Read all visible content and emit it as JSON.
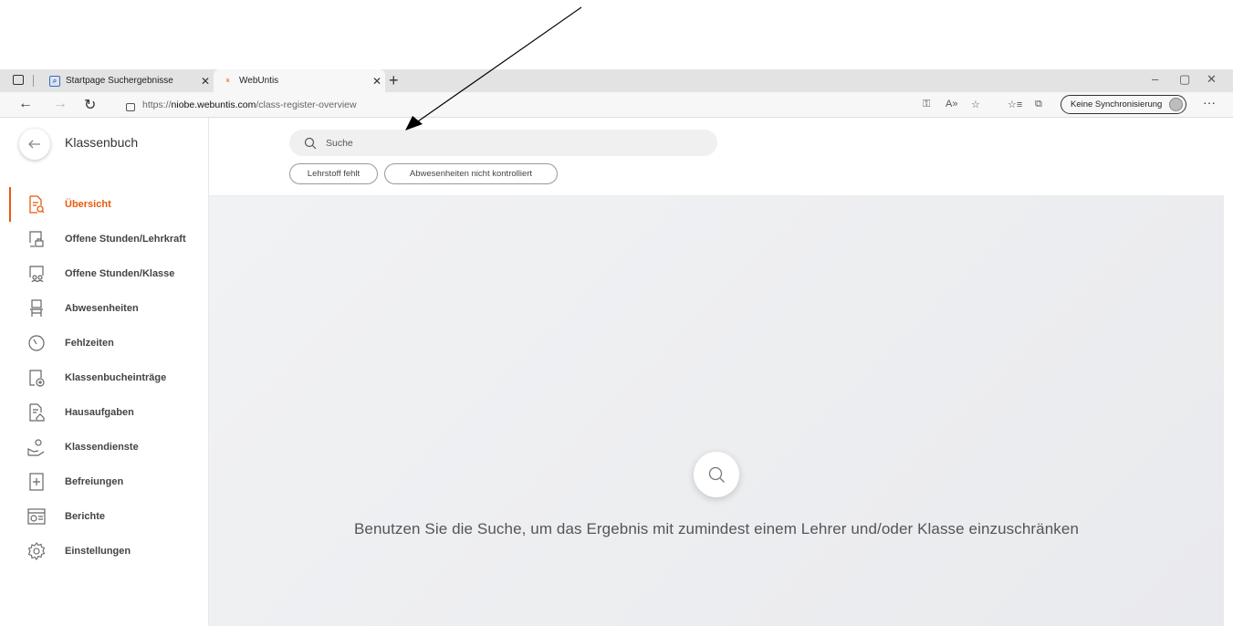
{
  "browser": {
    "tabs": [
      {
        "title": "Startpage Suchergebnisse",
        "favicon": "startpage-icon"
      },
      {
        "title": "WebUntis",
        "favicon": "webuntis-icon"
      }
    ],
    "window_controls": {
      "minimize": "–",
      "maximize": "▢",
      "close": "✕"
    },
    "url": {
      "prefix": "https://",
      "host": "niobe.webuntis.com",
      "path": "/class-register-overview"
    },
    "sync_label": "Keine Synchronisierung"
  },
  "sidebar": {
    "title": "Klassenbuch",
    "items": [
      {
        "label": "Übersicht",
        "icon": "overview-icon",
        "active": true
      },
      {
        "label": "Offene Stunden/Lehrkraft",
        "icon": "open-lessons-teacher-icon"
      },
      {
        "label": "Offene Stunden/Klasse",
        "icon": "open-lessons-class-icon"
      },
      {
        "label": "Abwesenheiten",
        "icon": "chair-icon"
      },
      {
        "label": "Fehlzeiten",
        "icon": "clock-icon"
      },
      {
        "label": "Klassenbucheinträge",
        "icon": "entry-add-icon"
      },
      {
        "label": "Hausaufgaben",
        "icon": "homework-icon"
      },
      {
        "label": "Klassendienste",
        "icon": "class-duty-icon"
      },
      {
        "label": "Befreiungen",
        "icon": "exemption-icon"
      },
      {
        "label": "Berichte",
        "icon": "report-icon"
      },
      {
        "label": "Einstellungen",
        "icon": "settings-icon"
      }
    ]
  },
  "search": {
    "placeholder": "Suche"
  },
  "filters": [
    "Lehrstoff fehlt",
    "Abwesenheiten nicht kontrolliert"
  ],
  "empty_state": {
    "message": "Benutzen Sie die Suche, um das Ergebnis mit zumindest einem Lehrer und/oder Klasse einzuschränken"
  },
  "colors": {
    "accent": "#e8590c",
    "tabbar": "#e3e3e3",
    "content_bg": "#eeeff1"
  }
}
